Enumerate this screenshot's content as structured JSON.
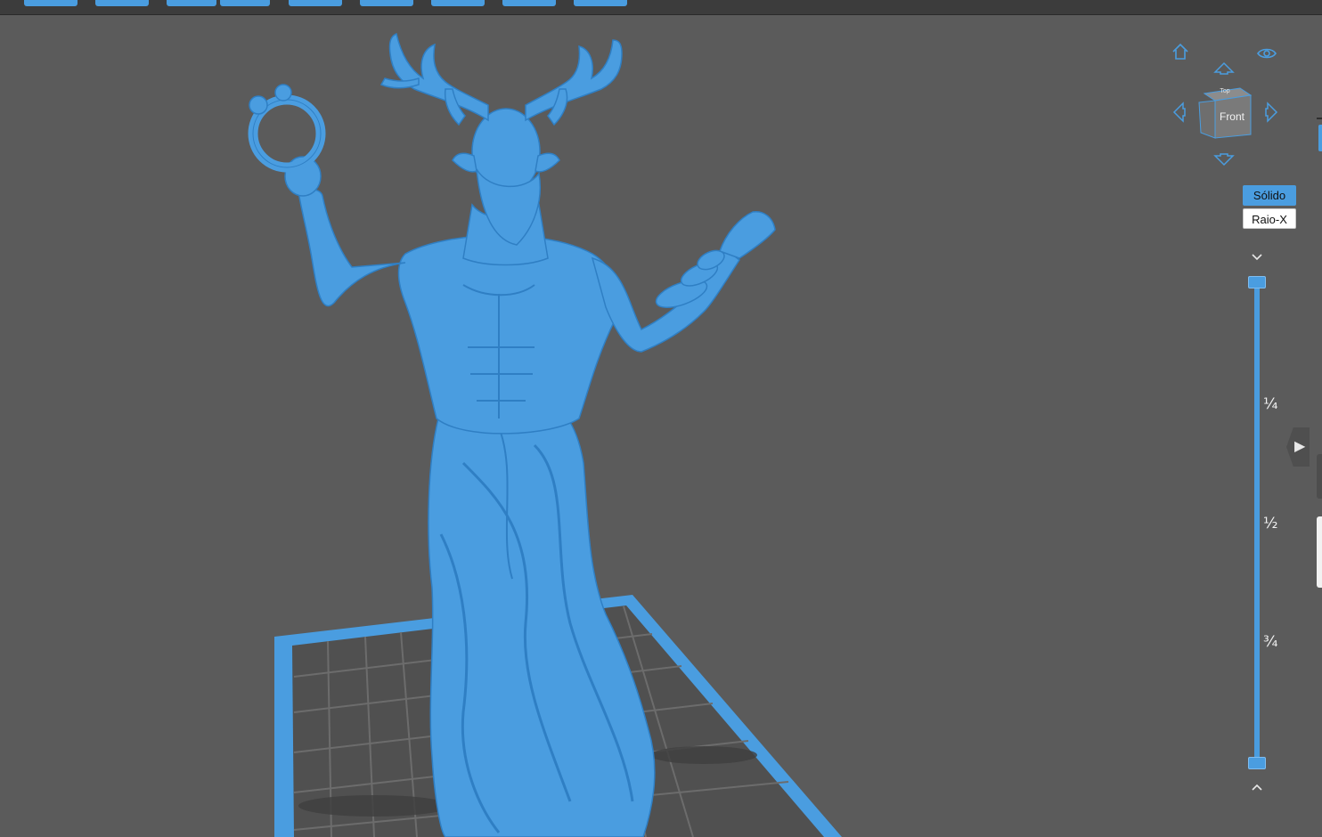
{
  "toolbar": {
    "buttons": [
      "tool-1",
      "tool-2",
      "tool-3",
      "tool-4",
      "tool-5",
      "tool-6",
      "tool-7",
      "tool-8",
      "tool-9"
    ]
  },
  "view_cube": {
    "front_label": "Front",
    "top_label": "Top",
    "icons": [
      "home-icon",
      "eye-icon",
      "arrow-up-icon",
      "arrow-left-icon",
      "arrow-right-icon",
      "arrow-down-icon"
    ]
  },
  "render_modes": {
    "solid": "Sólido",
    "xray": "Raio-X",
    "active": "solid"
  },
  "layer_slider": {
    "marks": [
      "¼",
      "½",
      "¾"
    ],
    "upper_value": 1,
    "lower_value": 0
  },
  "colors": {
    "model": "#4a9de0",
    "background": "#5b5b5b",
    "plate_grid": "#4d4d4d"
  },
  "model": {
    "subject": "horned druid statue with ring"
  }
}
